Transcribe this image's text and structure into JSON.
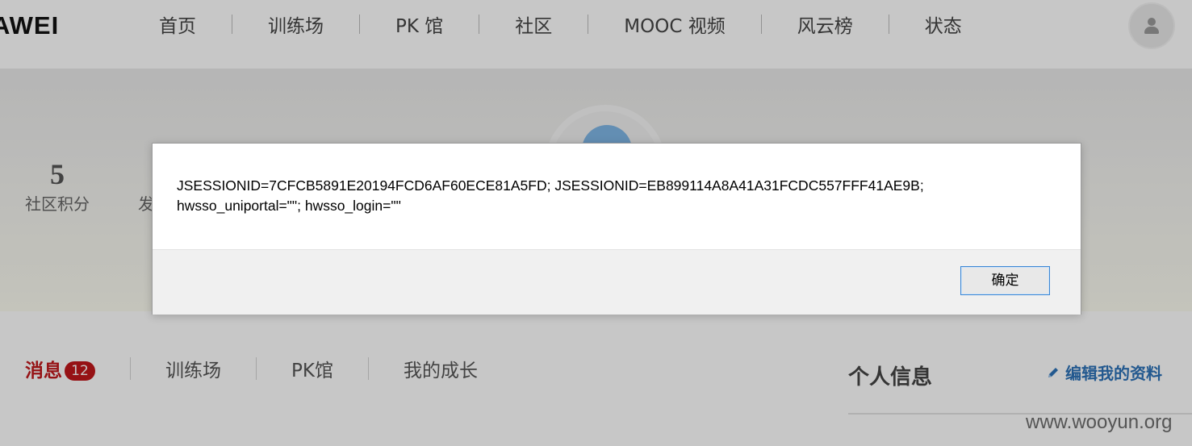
{
  "header": {
    "logo_text": "AWEI",
    "nav": [
      "首页",
      "训练场",
      "PK 馆",
      "社区",
      "MOOC 视频",
      "风云榜",
      "状态"
    ]
  },
  "profile": {
    "community_points_value": "5",
    "community_points_label": "社区积分",
    "second_stat_label": "发"
  },
  "tabs": {
    "messages_label": "消息",
    "messages_count": "12",
    "training": "训练场",
    "pk": "PK馆",
    "growth": "我的成长"
  },
  "side": {
    "personal_info": "个人信息",
    "edit_profile": "编辑我的资料"
  },
  "dialog": {
    "message_line1": "JSESSIONID=7CFCB5891E20194FCD6AF60ECE81A5FD; JSESSIONID=EB899114A8A41A31FCDC557FFF41AE9B;",
    "message_line2": "hwsso_uniportal=\"\"; hwsso_login=\"\"",
    "ok_label": "确定"
  },
  "watermark": "www.wooyun.org",
  "colors": {
    "accent_red": "#c0181b",
    "link_blue": "#2e73b8",
    "button_focus": "#3a86d4"
  },
  "icons": [
    "user-avatar-icon",
    "pencil-icon"
  ]
}
